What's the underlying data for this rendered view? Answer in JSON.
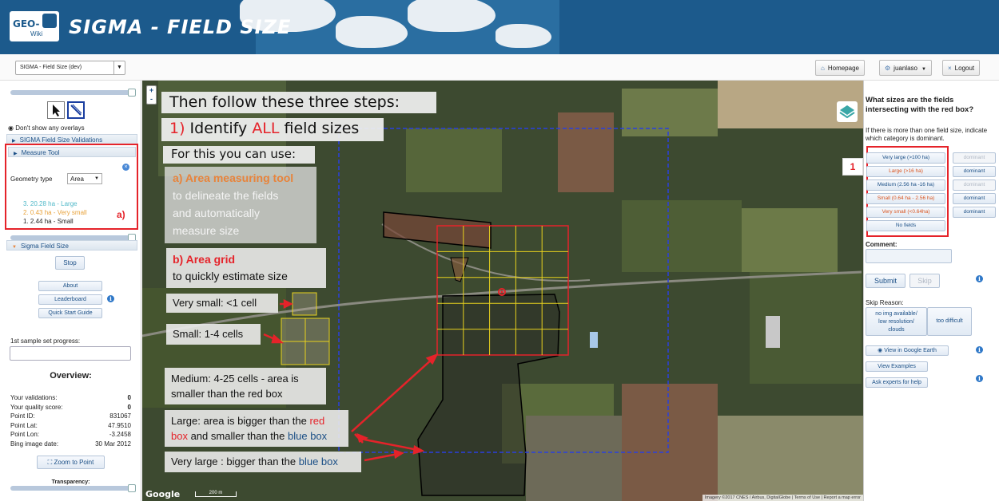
{
  "header": {
    "logo_text": "GEO-",
    "logo_sub": "Wiki",
    "title": "SIGMA - FIELD SIZE"
  },
  "topbar": {
    "project_select": "SIGMA - Field Size (dev)",
    "homepage_label": "Homepage",
    "user_label": "juanlaso",
    "logout_label": "Logout"
  },
  "left": {
    "overlay_radio_label": "Don't show any overlays",
    "validations_header": "SIGMA Field Size Validations",
    "measure_header": "Measure Tool",
    "geometry_label": "Geometry type",
    "geometry_value": "Area",
    "measurements": [
      {
        "text": "3. 20.28 ha - Large",
        "color": "#4fb8c8"
      },
      {
        "text": "2. 0.43 ha - Very small",
        "color": "#e8a23a"
      },
      {
        "text": "1. 2.44 ha - Small",
        "color": "#222222"
      }
    ],
    "annotation_a": "a)",
    "sigma_header": "Sigma Field Size",
    "stop_label": "Stop",
    "about_label": "About",
    "leaderboard_label": "Leaderboard",
    "quickstart_label": "Quick Start Guide",
    "progress_label": "1st sample set progress:",
    "overview_title": "Overview:",
    "overview": [
      {
        "k": "Your validations:",
        "v": "0",
        "bold": true
      },
      {
        "k": "Your quality score:",
        "v": "0",
        "bold": true
      },
      {
        "k": "Point ID:",
        "v": "831067",
        "bold": false
      },
      {
        "k": "Point Lat:",
        "v": "47.9510",
        "bold": false
      },
      {
        "k": "Point Lon:",
        "v": "-3.2458",
        "bold": false
      },
      {
        "k": "Bing image date:",
        "v": "30 Mar 2012",
        "bold": false
      }
    ],
    "zoom_to_point_label": "Zoom to Point",
    "transparency_label": "Transparency:"
  },
  "map": {
    "zoom_in": "+",
    "zoom_out": "-",
    "steps_title": "Then follow these three steps:",
    "identify_prefix": "1) ",
    "identify_text_a": "Identify ",
    "identify_all": "ALL",
    "identify_text_b": " field sizes",
    "use_label": "For this you can use:",
    "area_tool_prefix": "a) ",
    "area_tool_title": "Area measuring tool",
    "area_tool_body_1": "to delineate the fields",
    "area_tool_body_2": "and automatically",
    "area_tool_body_3": "measure size",
    "grid_prefix": "b) ",
    "grid_title": "Area grid",
    "grid_body": "to quickly estimate size",
    "very_small": "Very small: <1  cell",
    "small": "Small: 1-4 cells",
    "medium_1": "Medium:  4-25 cells - area is",
    "medium_2": "smaller than the red box",
    "large_1a": "Large: area is bigger than the ",
    "large_1b": "red",
    "large_2a": "box",
    "large_2b": " and smaller than the ",
    "large_2c": "blue box",
    "very_large_a": "Very large : bigger than the ",
    "very_large_b": "blue box",
    "google_label": "Google",
    "scale_label": "200 m",
    "attribution": "Imagery ©2017 CNES / Airbus, DigitalGlobe  |  Terms of Use  |  Report a map error"
  },
  "right": {
    "question": "What sizes are the fields intersecting with the red box?",
    "subtext": "If there is more than one field size, indicate which category is dominant.",
    "categories": [
      {
        "label": "Very large (>100 ha)",
        "color": "#1b4f86",
        "dominant": "dominant",
        "dominant_enabled": false
      },
      {
        "label": "Large (>16 ha)",
        "color": "#d9531e",
        "dominant": "dominant",
        "dominant_enabled": true
      },
      {
        "label": "Medium (2.56 ha -16 ha)",
        "color": "#1b4f86",
        "dominant": "dominant",
        "dominant_enabled": false
      },
      {
        "label": "Small (0.64 ha - 2.56 ha)",
        "color": "#d9531e",
        "dominant": "dominant",
        "dominant_enabled": true
      },
      {
        "label": "Very small (<0.64ha)",
        "color": "#d9531e",
        "dominant": "dominant",
        "dominant_enabled": true
      },
      {
        "label": "No fields",
        "color": "#1b4f86"
      }
    ],
    "label_1": "1",
    "comment_label": "Comment:",
    "submit_label": "Submit",
    "skip_label": "Skip",
    "skip_reason_label": "Skip Reason:",
    "reason_no_img_1": "no img available/",
    "reason_no_img_2": "low resolution/",
    "reason_no_img_3": "clouds",
    "reason_difficult": "too difficult",
    "google_earth_label": "View in Google Earth",
    "examples_label": "View Examples",
    "experts_label": "Ask experts for help",
    "info_glyph": "i"
  },
  "colors": {
    "accent_red": "#e5232a",
    "nav_blue": "#1b4f86",
    "banner_blue": "#1c5a8c",
    "grid_yellow": "#e8d21e",
    "blue_box": "#2a3fe0"
  }
}
